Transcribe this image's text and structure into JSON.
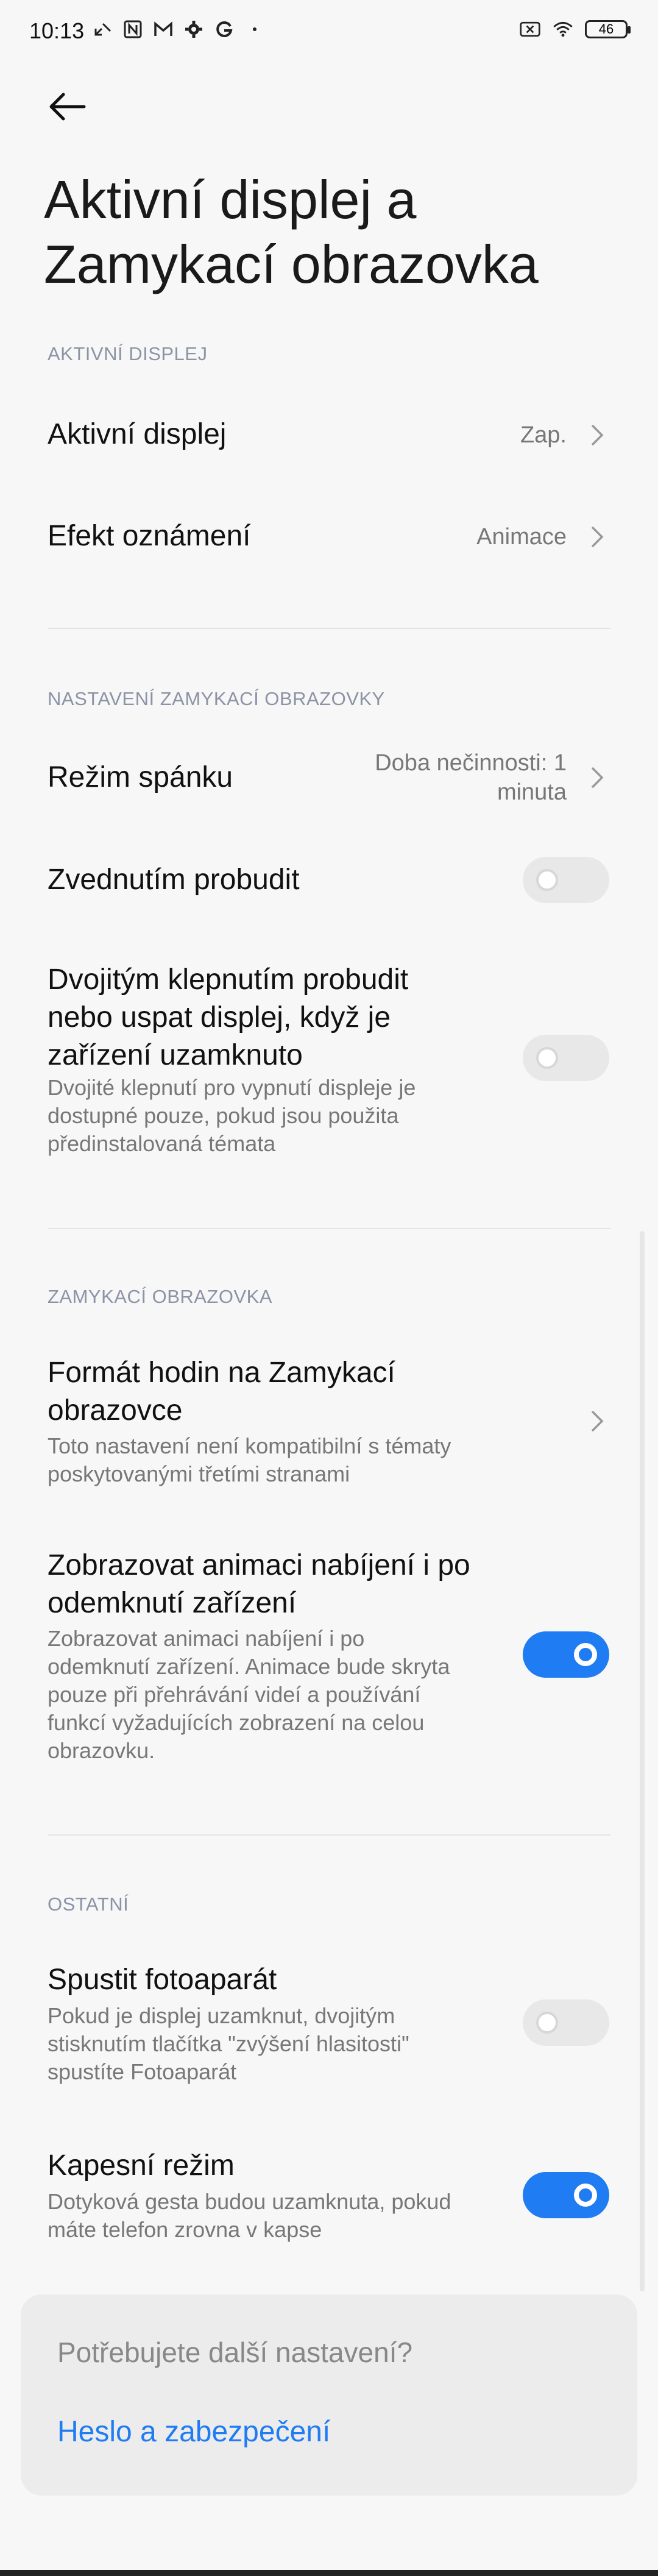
{
  "status_bar": {
    "time": "10:13",
    "battery": "46",
    "left_icons": [
      "missed-call-icon",
      "nfc-icon",
      "gmail-icon",
      "settings-icon",
      "google-icon",
      "dot-icon"
    ],
    "right_icons": [
      "sim-x-icon",
      "wifi-icon",
      "battery-icon"
    ]
  },
  "header": {
    "title_line1": "Aktivní displej a",
    "title_line2": "Zamykací obrazovka"
  },
  "sections": {
    "active_display": {
      "header": "AKTIVNÍ DISPLEJ",
      "active_display_title": "Aktivní displej",
      "active_display_value": "Zap.",
      "notification_effect_title": "Efekt oznámení",
      "notification_effect_value": "Animace"
    },
    "lock_settings": {
      "header": "NASTAVENÍ ZAMYKACÍ OBRAZOVKY",
      "sleep_title": "Režim spánku",
      "sleep_value_line1": "Doba nečinnosti: 1",
      "sleep_value_line2": "minuta",
      "raise_title": "Zvednutím probudit",
      "raise_on": false,
      "double_tap_title_line1": "Dvojitým klepnutím probudit",
      "double_tap_title_line2": "nebo uspat displej, když je",
      "double_tap_title_line3": "zařízení uzamknuto",
      "double_tap_sub_line1": "Dvojité klepnutí pro vypnutí displeje je",
      "double_tap_sub_line2": "dostupné pouze, pokud jsou použita",
      "double_tap_sub_line3": "předinstalovaná témata",
      "double_tap_on": false
    },
    "lock_screen": {
      "header": "ZAMYKACÍ OBRAZOVKA",
      "clock_title_line1": "Formát hodin na Zamykací",
      "clock_title_line2": "obrazovce",
      "clock_sub_line1": "Toto nastavení není kompatibilní s tématy",
      "clock_sub_line2": "poskytovanými třetími stranami",
      "charging_title_line1": "Zobrazovat animaci nabíjení i po",
      "charging_title_line2": "odemknutí zařízení",
      "charging_sub_line1": "Zobrazovat animaci nabíjení i po",
      "charging_sub_line2": "odemknutí zařízení. Animace bude skryta",
      "charging_sub_line3": "pouze při přehrávání videí a používání",
      "charging_sub_line4": "funkcí vyžadujících zobrazení na celou",
      "charging_sub_line5": "obrazovku.",
      "charging_on": true
    },
    "other": {
      "header": "OSTATNÍ",
      "camera_title": "Spustit fotoaparát",
      "camera_sub_line1": "Pokud je displej uzamknut, dvojitým",
      "camera_sub_line2": "stisknutím tlačítka \"zvýšení hlasitosti\"",
      "camera_sub_line3": "spustíte Fotoaparát",
      "camera_on": false,
      "pocket_title": "Kapesní režim",
      "pocket_sub_line1": "Dotyková gesta budou uzamknuta, pokud",
      "pocket_sub_line2": "máte telefon zrovna v kapse",
      "pocket_on": true
    }
  },
  "card": {
    "title": "Potřebujete další nastavení?",
    "link": "Heslo a zabezpečení"
  },
  "colors": {
    "accent": "#1f7cf2",
    "section_header": "#8c93a6",
    "background": "#f7f7f7"
  }
}
